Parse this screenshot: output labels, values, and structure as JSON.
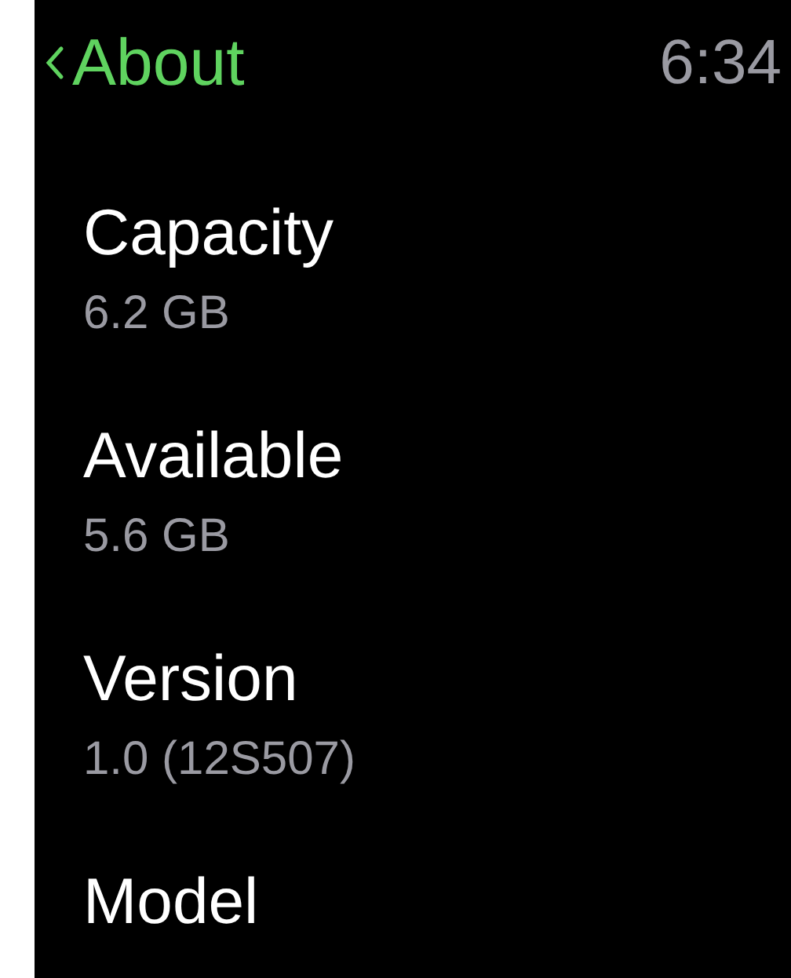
{
  "header": {
    "title": "About",
    "time": "6:34"
  },
  "items": [
    {
      "label": "Capacity",
      "value": "6.2 GB"
    },
    {
      "label": "Available",
      "value": "5.6 GB"
    },
    {
      "label": "Version",
      "value": "1.0 (12S507)"
    },
    {
      "label": "Model"
    }
  ]
}
